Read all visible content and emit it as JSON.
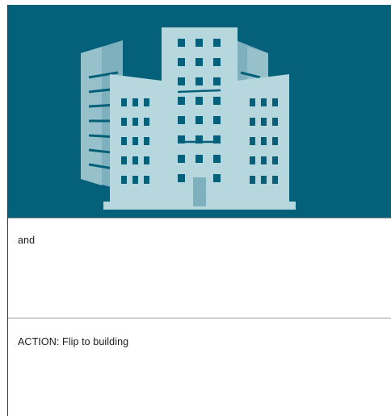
{
  "hero": {
    "icon": "office-buildings-icon",
    "background_color": "#046179",
    "icon_color": "#b7d7de"
  },
  "sections": [
    {
      "text": "and"
    },
    {
      "text": "ACTION: Flip to building"
    }
  ]
}
